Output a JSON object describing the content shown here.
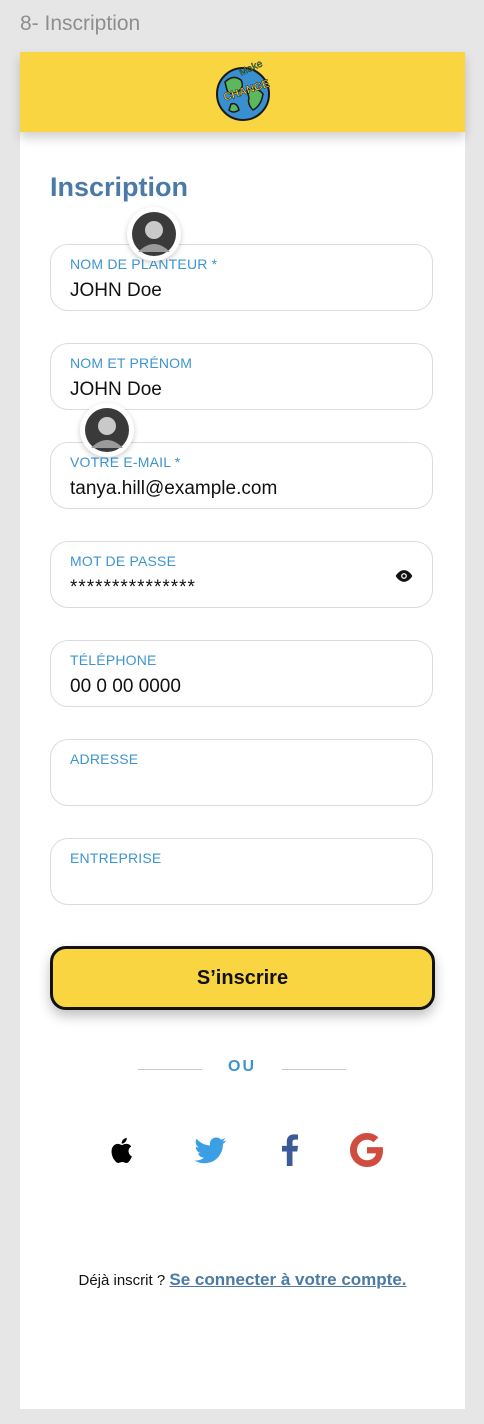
{
  "frame_title": "8- Inscription",
  "logo": {
    "text_line1": "Make",
    "text_line2": "CHANGE"
  },
  "page_title": "Inscription",
  "fields": [
    {
      "label": "NOM DE PLANTEUR *",
      "value": "JOHN Doe"
    },
    {
      "label": "NOM ET PRÉNOM",
      "value": "JOHN Doe"
    },
    {
      "label": "VOTRE E-MAIL *",
      "value": "tanya.hill@example.com"
    },
    {
      "label": "MOT DE PASSE",
      "value": "***************"
    },
    {
      "label": "TÉLÉPHONE",
      "value": "00 0 00 0000"
    },
    {
      "label": "ADRESSE",
      "value": ""
    },
    {
      "label": "ENTREPRISE",
      "value": ""
    }
  ],
  "submit_label": "S’inscrire",
  "divider_text": "OU",
  "social_icons": [
    "apple-icon",
    "twitter-icon",
    "facebook-icon",
    "google-icon"
  ],
  "footer": {
    "prefix": "Déjà inscrit ? ",
    "link": "Se connecter à votre compte."
  },
  "colors": {
    "accent_yellow": "#f9d641",
    "title_blue": "#4a7aa5",
    "label_blue": "#3d95cf"
  }
}
